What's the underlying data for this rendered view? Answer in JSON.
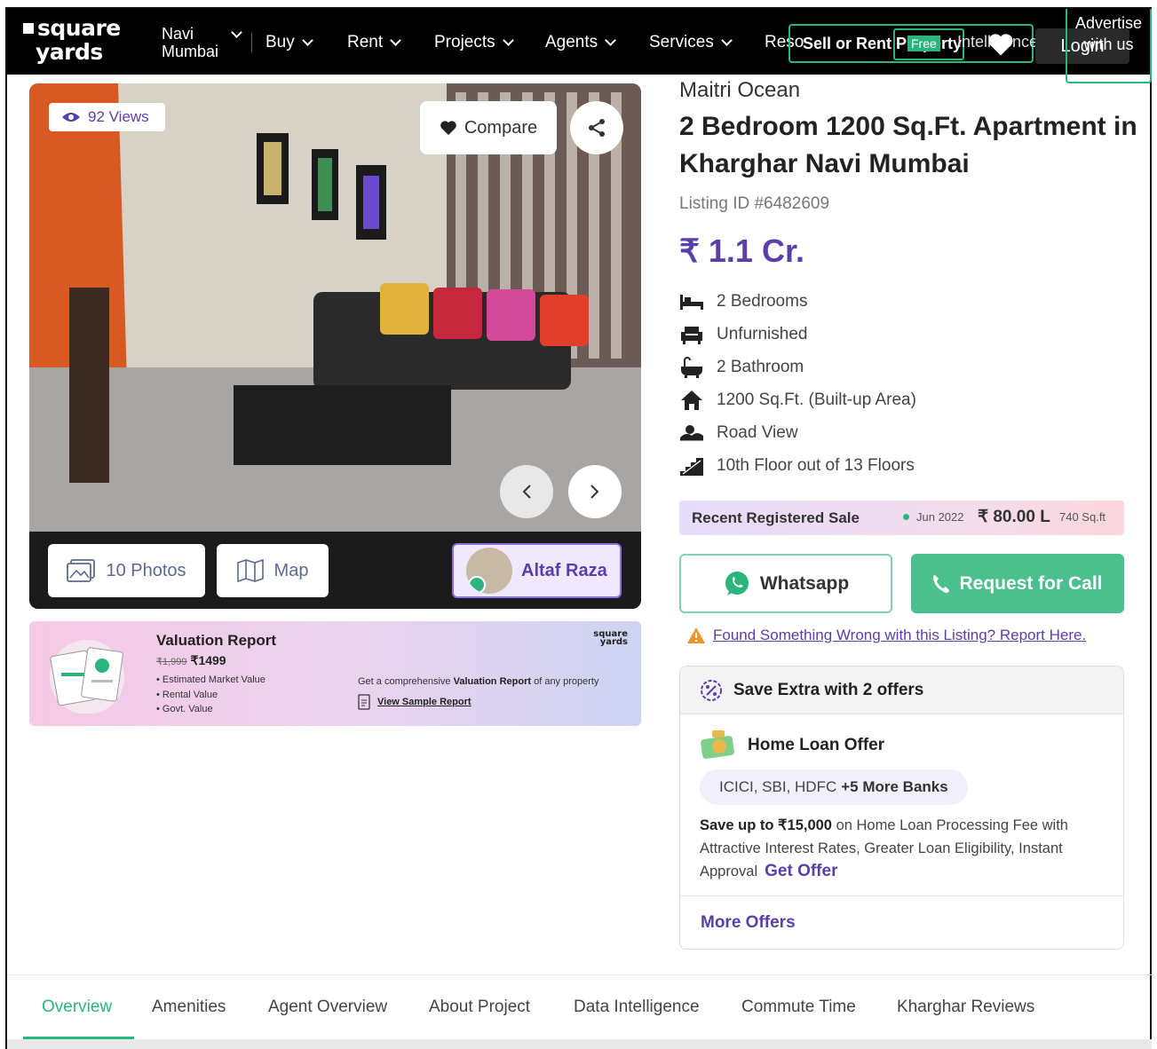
{
  "nav": {
    "logo_line1": "square",
    "logo_line2": "yards",
    "city": "Navi Mumbai",
    "items": [
      {
        "label": "Buy"
      },
      {
        "label": "Rent"
      },
      {
        "label": "Projects"
      },
      {
        "label": "Agents"
      },
      {
        "label": "Services"
      }
    ],
    "resources_label": "Reso",
    "sell_label": "Sell or Rent Property",
    "free_badge": "Free",
    "intelligence_label": "Intelligence",
    "login": "Login",
    "advertise": "Advertise with us"
  },
  "gallery": {
    "views": "92 Views",
    "compare": "Compare",
    "photos": "10 Photos",
    "map": "Map",
    "agent": "Altaf Raza"
  },
  "valuation": {
    "title": "Valuation Report",
    "old_price": "₹1,999",
    "price": "₹1499",
    "features": [
      "Estimated Market Value",
      "Rental Value",
      "Govt. Value"
    ],
    "desc_prefix": "Get a comprehensive",
    "desc_bold": "Valuation Report",
    "desc_suffix": "of any property",
    "link": "View Sample Report",
    "logo": "square yards"
  },
  "listing": {
    "project": "Maitri Ocean",
    "title": "2 Bedroom 1200 Sq.Ft. Apartment in Kharghar Navi Mumbai",
    "listing_id": "Listing ID #6482609",
    "price": "₹ 1.1 Cr.",
    "features": [
      {
        "icon": "bed-icon",
        "label": "2 Bedrooms"
      },
      {
        "icon": "armchair-icon",
        "label": "Unfurnished"
      },
      {
        "icon": "bathtub-icon",
        "label": "2 Bathroom"
      },
      {
        "icon": "home-icon",
        "label": "1200 Sq.Ft. (Built-up Area)"
      },
      {
        "icon": "road-view-icon",
        "label": "Road View"
      },
      {
        "icon": "stairs-icon",
        "label": "10th Floor out of 13 Floors"
      }
    ]
  },
  "recent_sale": {
    "label": "Recent Registered Sale",
    "date": "Jun 2022",
    "price": "₹ 80.00 L",
    "area": "740 Sq.ft"
  },
  "actions": {
    "whatsapp": "Whatsapp",
    "call": "Request for Call",
    "report": "Found Something Wrong with this Listing? Report Here."
  },
  "offers": {
    "header": "Save Extra with 2 offers",
    "home_loan_title": "Home Loan Offer",
    "banks": "ICICI, SBI, HDFC",
    "banks_more": "+5 More Banks",
    "save_bold": "Save up to ₹15,000",
    "save_text": "on Home Loan Processing Fee with Attractive Interest Rates, Greater Loan Eligibility, Instant Approval",
    "get_offer": "Get Offer",
    "more_offers": "More Offers"
  },
  "tabs": [
    {
      "label": "Overview",
      "active": true
    },
    {
      "label": "Amenities"
    },
    {
      "label": "Agent Overview"
    },
    {
      "label": "About Project"
    },
    {
      "label": "Data Intelligence"
    },
    {
      "label": "Commute Time"
    },
    {
      "label": "Kharghar Reviews"
    }
  ],
  "colors": {
    "brand_purple": "#5a3fa8",
    "brand_green": "#2bb47e"
  }
}
